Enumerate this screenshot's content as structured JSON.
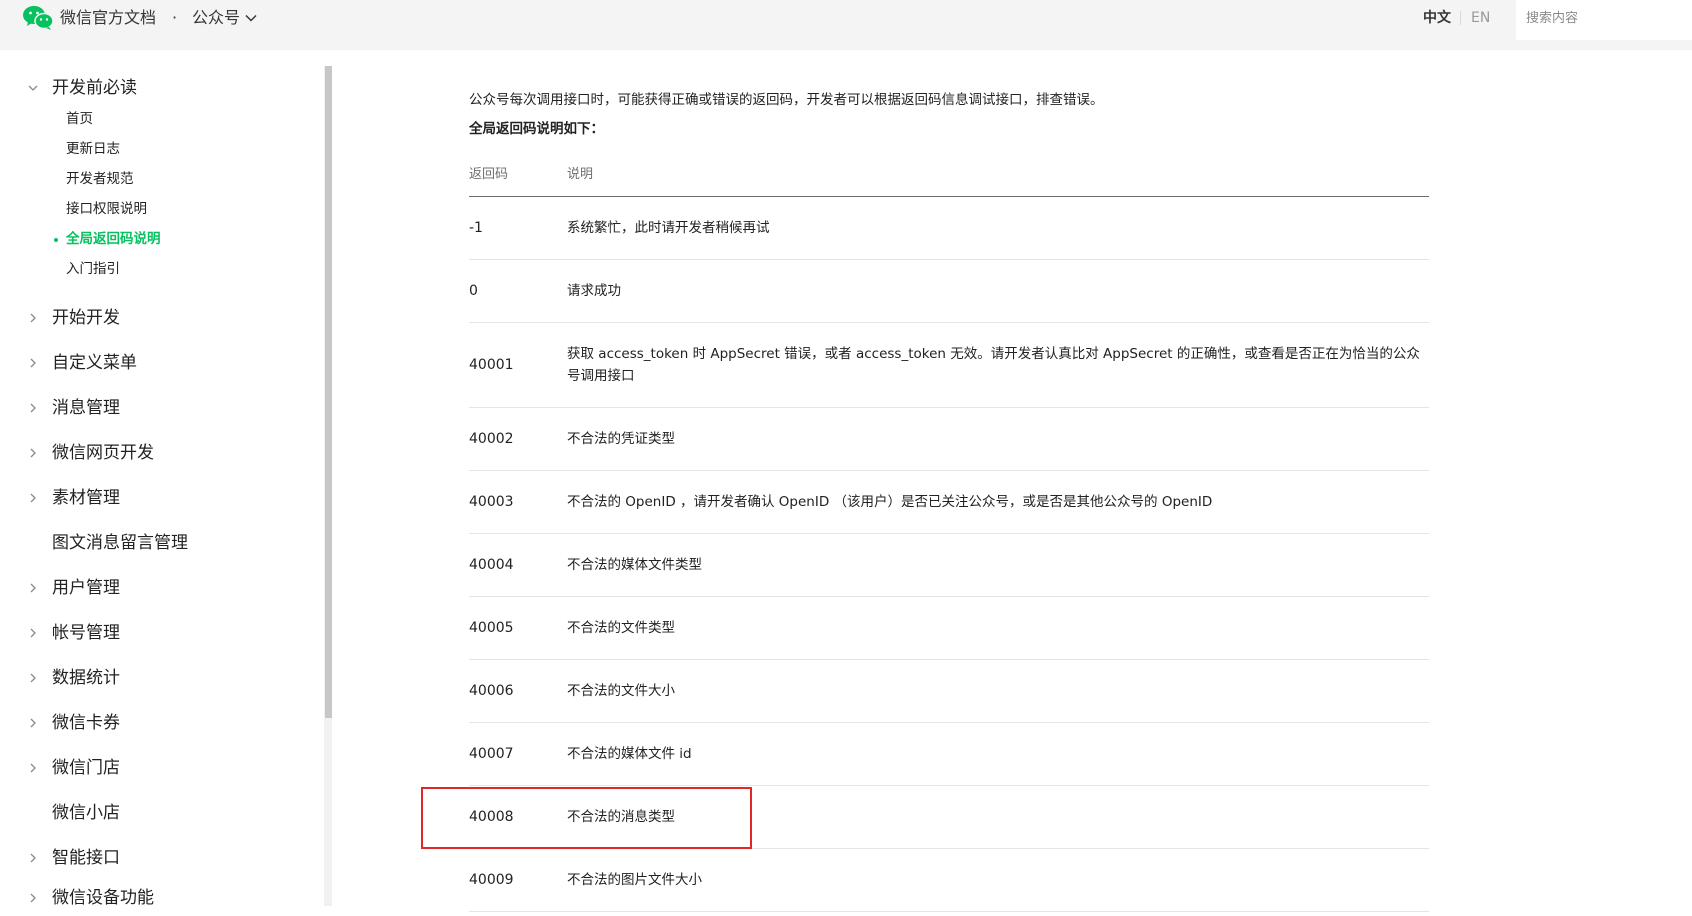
{
  "header": {
    "brand": "微信官方文档",
    "separator": "·",
    "product": "公众号",
    "lang_zh": "中文",
    "lang_en": "EN",
    "search_placeholder": "搜索内容",
    "accent_color": "#07c160"
  },
  "sidebar": {
    "sections": [
      {
        "label": "开发前必读",
        "expanded": true,
        "children": [
          {
            "label": "首页",
            "active": false
          },
          {
            "label": "更新日志",
            "active": false
          },
          {
            "label": "开发者规范",
            "active": false
          },
          {
            "label": "接口权限说明",
            "active": false
          },
          {
            "label": "全局返回码说明",
            "active": true
          },
          {
            "label": "入门指引",
            "active": false
          }
        ]
      },
      {
        "label": "开始开发",
        "has_children": true
      },
      {
        "label": "自定义菜单",
        "has_children": true
      },
      {
        "label": "消息管理",
        "has_children": true
      },
      {
        "label": "微信网页开发",
        "has_children": true
      },
      {
        "label": "素材管理",
        "has_children": true
      },
      {
        "label": "图文消息留言管理",
        "has_children": false
      },
      {
        "label": "用户管理",
        "has_children": true
      },
      {
        "label": "帐号管理",
        "has_children": true
      },
      {
        "label": "数据统计",
        "has_children": true
      },
      {
        "label": "微信卡券",
        "has_children": true
      },
      {
        "label": "微信门店",
        "has_children": true
      },
      {
        "label": "微信小店",
        "has_children": false
      },
      {
        "label": "智能接口",
        "has_children": true
      },
      {
        "label": "微信设备功能",
        "has_children": true
      }
    ]
  },
  "content": {
    "intro": "公众号每次调用接口时，可能获得正确或错误的返回码，开发者可以根据返回码信息调试接口，排查错误。",
    "sub_intro": "全局返回码说明如下：",
    "table": {
      "headers": [
        "返回码",
        "说明"
      ],
      "rows": [
        {
          "code": "-1",
          "desc": "系统繁忙，此时请开发者稍候再试"
        },
        {
          "code": "0",
          "desc": "请求成功"
        },
        {
          "code": "40001",
          "desc": "获取 access_token 时 AppSecret 错误，或者 access_token 无效。请开发者认真比对 AppSecret 的正确性，或查看是否正在为恰当的公众号调用接口"
        },
        {
          "code": "40002",
          "desc": "不合法的凭证类型"
        },
        {
          "code": "40003",
          "desc": "不合法的 OpenID ，请开发者确认 OpenID （该用户）是否已关注公众号，或是否是其他公众号的 OpenID"
        },
        {
          "code": "40004",
          "desc": "不合法的媒体文件类型"
        },
        {
          "code": "40005",
          "desc": "不合法的文件类型"
        },
        {
          "code": "40006",
          "desc": "不合法的文件大小"
        },
        {
          "code": "40007",
          "desc": "不合法的媒体文件 id"
        },
        {
          "code": "40008",
          "desc": "不合法的消息类型",
          "highlighted": true
        },
        {
          "code": "40009",
          "desc": "不合法的图片文件大小"
        }
      ]
    },
    "highlight_color": "#e02828"
  }
}
